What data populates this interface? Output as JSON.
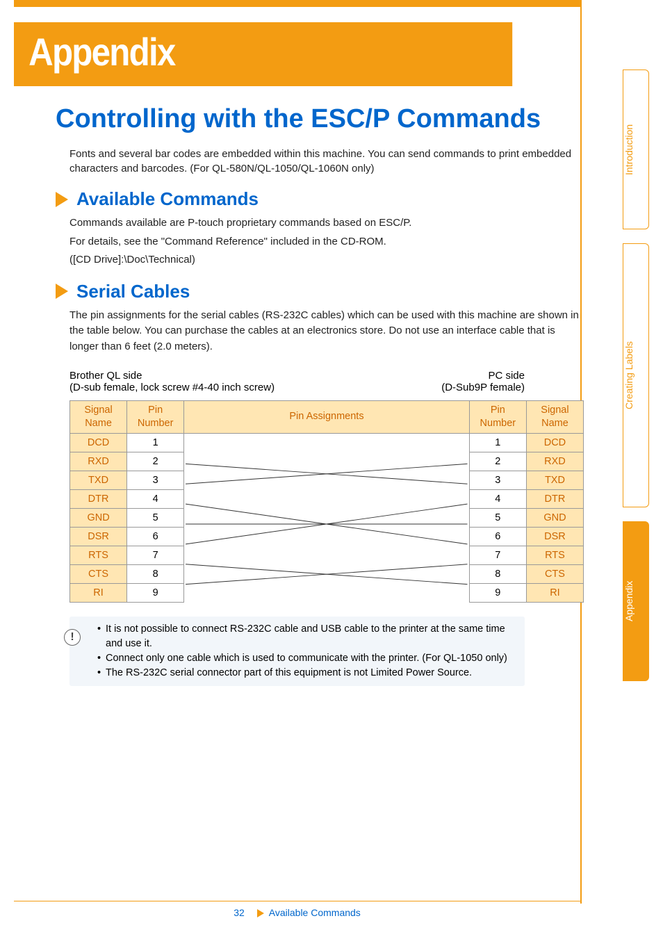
{
  "banner": {
    "title": "Appendix"
  },
  "h1": "Controlling with the ESC/P Commands",
  "intro": "Fonts and several bar codes are embedded within this machine. You can send commands to print embedded characters and barcodes. (For QL-580N/QL-1050/QL-1060N only)",
  "section1": {
    "title": "Available Commands",
    "p1": "Commands available are P-touch proprietary commands based on ESC/P.",
    "p2": "For details, see the \"Command Reference\" included in the CD-ROM.",
    "p3": "([CD Drive]:\\Doc\\Technical)"
  },
  "section2": {
    "title": "Serial Cables",
    "p": "The pin assignments for the serial cables (RS-232C cables) which can be used with this machine are shown in the table below. You can purchase the cables at an electronics store. Do not use an interface cable that is longer than 6 feet (2.0 meters).",
    "left_side_label": "Brother QL side",
    "left_side_sub": "(D-sub female, lock screw #4-40 inch screw)",
    "right_side_label": "PC side",
    "right_side_sub": "(D-Sub9P female)"
  },
  "table": {
    "headers": {
      "sig_left": "Signal\nName",
      "pin_left": "Pin\nNumber",
      "assign": "Pin Assignments",
      "pin_right": "Pin\nNumber",
      "sig_right": "Signal\nName"
    },
    "rows": [
      {
        "sigL": "DCD",
        "pinL": "1",
        "pinR": "1",
        "sigR": "DCD"
      },
      {
        "sigL": "RXD",
        "pinL": "2",
        "pinR": "2",
        "sigR": "RXD"
      },
      {
        "sigL": "TXD",
        "pinL": "3",
        "pinR": "3",
        "sigR": "TXD"
      },
      {
        "sigL": "DTR",
        "pinL": "4",
        "pinR": "4",
        "sigR": "DTR"
      },
      {
        "sigL": "GND",
        "pinL": "5",
        "pinR": "5",
        "sigR": "GND"
      },
      {
        "sigL": "DSR",
        "pinL": "6",
        "pinR": "6",
        "sigR": "DSR"
      },
      {
        "sigL": "RTS",
        "pinL": "7",
        "pinR": "7",
        "sigR": "RTS"
      },
      {
        "sigL": "CTS",
        "pinL": "8",
        "pinR": "8",
        "sigR": "CTS"
      },
      {
        "sigL": "RI",
        "pinL": "9",
        "pinR": "9",
        "sigR": "RI"
      }
    ]
  },
  "notes": {
    "n1": "It is not possible to connect RS-232C cable and USB cable to the printer at the same time and use it.",
    "n2": "Connect only one cable which is used to communicate with the printer. (For QL-1050 only)",
    "n3": "The RS-232C serial connector part of this equipment is not Limited Power Source."
  },
  "tabs": {
    "t1": "Introduction",
    "t2": "Creating Labels",
    "t3": "Appendix"
  },
  "footer": {
    "page": "32",
    "section": "Available Commands"
  }
}
